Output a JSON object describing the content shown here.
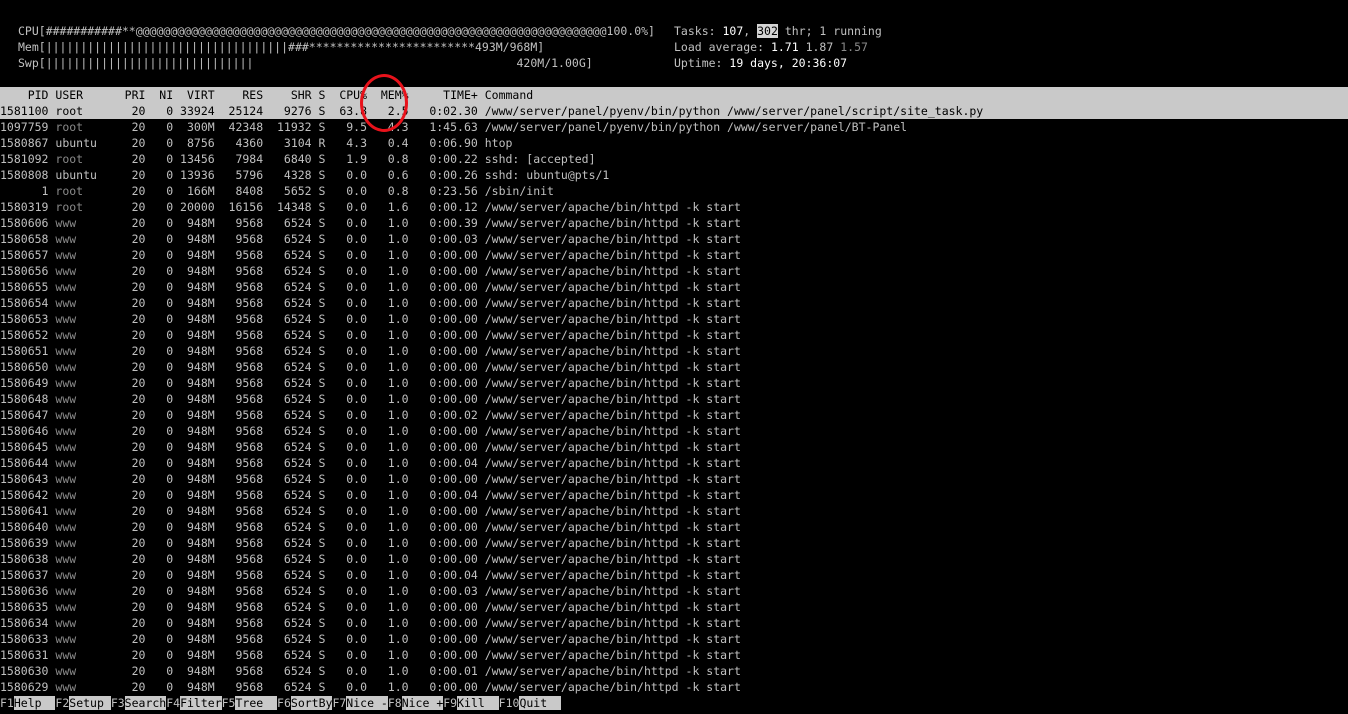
{
  "meters": {
    "cpu": {
      "label": "CPU",
      "bar": "[###########**@@@@@@@@@@@@@@@@@@@@@@@@@@@@@@@@@@@@@@@@@@@@@@@@@@@@@@@@@@@@@@@@@@@@100.0%]"
    },
    "mem": {
      "label": "Mem",
      "bar": "[|||||||||||||||||||||||||||||||||||###************************493M/968M]"
    },
    "swp": {
      "label": "Swp",
      "bar": "[||||||||||||||||||||||||||||||                                      420M/1.00G]"
    }
  },
  "summary": {
    "tasks_label": "Tasks: ",
    "tasks_count": "107",
    "tasks_sep": ", ",
    "threads_count": "302",
    "tasks_suffix": " thr; 1 running",
    "load_label": "Load average: ",
    "load_1": "1.71",
    "load_5": "1.87",
    "load_15": "1.57",
    "uptime_label": "Uptime: ",
    "uptime_value": "19 days, 20:36:07"
  },
  "table": {
    "headers": [
      "PID",
      "USER",
      "PRI",
      "NI",
      "VIRT",
      "RES",
      "SHR",
      "S",
      "CPU%",
      "MEM%",
      "TIME+",
      "Command"
    ],
    "rows": [
      {
        "pid": "1581100",
        "user": "root",
        "pri": "20",
        "ni": "0",
        "virt": "33924",
        "res": "25124",
        "shr": "9276",
        "s": "S",
        "cpu": "63.8",
        "mem": "2.5",
        "time": "0:02.30",
        "cmd": "/www/server/panel/pyenv/bin/python /www/server/panel/script/site_task.py"
      },
      {
        "pid": "1097759",
        "user": "root",
        "pri": "20",
        "ni": "0",
        "virt": "300M",
        "res": "42348",
        "shr": "11932",
        "s": "S",
        "cpu": "9.5",
        "mem": "4.3",
        "time": "1:45.63",
        "cmd": "/www/server/panel/pyenv/bin/python /www/server/panel/BT-Panel"
      },
      {
        "pid": "1580867",
        "user": "ubuntu",
        "pri": "20",
        "ni": "0",
        "virt": "8756",
        "res": "4360",
        "shr": "3104",
        "s": "R",
        "cpu": "4.3",
        "mem": "0.4",
        "time": "0:06.90",
        "cmd": "htop"
      },
      {
        "pid": "1581092",
        "user": "root",
        "pri": "20",
        "ni": "0",
        "virt": "13456",
        "res": "7984",
        "shr": "6840",
        "s": "S",
        "cpu": "1.9",
        "mem": "0.8",
        "time": "0:00.22",
        "cmd": "sshd: [accepted]"
      },
      {
        "pid": "1580808",
        "user": "ubuntu",
        "pri": "20",
        "ni": "0",
        "virt": "13936",
        "res": "5796",
        "shr": "4328",
        "s": "S",
        "cpu": "0.0",
        "mem": "0.6",
        "time": "0:00.26",
        "cmd": "sshd: ubuntu@pts/1"
      },
      {
        "pid": "1",
        "user": "root",
        "pri": "20",
        "ni": "0",
        "virt": "166M",
        "res": "8408",
        "shr": "5652",
        "s": "S",
        "cpu": "0.0",
        "mem": "0.8",
        "time": "0:23.56",
        "cmd": "/sbin/init"
      },
      {
        "pid": "1580319",
        "user": "root",
        "pri": "20",
        "ni": "0",
        "virt": "20000",
        "res": "16156",
        "shr": "14348",
        "s": "S",
        "cpu": "0.0",
        "mem": "1.6",
        "time": "0:00.12",
        "cmd": "/www/server/apache/bin/httpd -k start"
      },
      {
        "pid": "1580606",
        "user": "www",
        "pri": "20",
        "ni": "0",
        "virt": "948M",
        "res": "9568",
        "shr": "6524",
        "s": "S",
        "cpu": "0.0",
        "mem": "1.0",
        "time": "0:00.39",
        "cmd": "/www/server/apache/bin/httpd -k start"
      },
      {
        "pid": "1580658",
        "user": "www",
        "pri": "20",
        "ni": "0",
        "virt": "948M",
        "res": "9568",
        "shr": "6524",
        "s": "S",
        "cpu": "0.0",
        "mem": "1.0",
        "time": "0:00.03",
        "cmd": "/www/server/apache/bin/httpd -k start"
      },
      {
        "pid": "1580657",
        "user": "www",
        "pri": "20",
        "ni": "0",
        "virt": "948M",
        "res": "9568",
        "shr": "6524",
        "s": "S",
        "cpu": "0.0",
        "mem": "1.0",
        "time": "0:00.00",
        "cmd": "/www/server/apache/bin/httpd -k start"
      },
      {
        "pid": "1580656",
        "user": "www",
        "pri": "20",
        "ni": "0",
        "virt": "948M",
        "res": "9568",
        "shr": "6524",
        "s": "S",
        "cpu": "0.0",
        "mem": "1.0",
        "time": "0:00.00",
        "cmd": "/www/server/apache/bin/httpd -k start"
      },
      {
        "pid": "1580655",
        "user": "www",
        "pri": "20",
        "ni": "0",
        "virt": "948M",
        "res": "9568",
        "shr": "6524",
        "s": "S",
        "cpu": "0.0",
        "mem": "1.0",
        "time": "0:00.00",
        "cmd": "/www/server/apache/bin/httpd -k start"
      },
      {
        "pid": "1580654",
        "user": "www",
        "pri": "20",
        "ni": "0",
        "virt": "948M",
        "res": "9568",
        "shr": "6524",
        "s": "S",
        "cpu": "0.0",
        "mem": "1.0",
        "time": "0:00.00",
        "cmd": "/www/server/apache/bin/httpd -k start"
      },
      {
        "pid": "1580653",
        "user": "www",
        "pri": "20",
        "ni": "0",
        "virt": "948M",
        "res": "9568",
        "shr": "6524",
        "s": "S",
        "cpu": "0.0",
        "mem": "1.0",
        "time": "0:00.00",
        "cmd": "/www/server/apache/bin/httpd -k start"
      },
      {
        "pid": "1580652",
        "user": "www",
        "pri": "20",
        "ni": "0",
        "virt": "948M",
        "res": "9568",
        "shr": "6524",
        "s": "S",
        "cpu": "0.0",
        "mem": "1.0",
        "time": "0:00.00",
        "cmd": "/www/server/apache/bin/httpd -k start"
      },
      {
        "pid": "1580651",
        "user": "www",
        "pri": "20",
        "ni": "0",
        "virt": "948M",
        "res": "9568",
        "shr": "6524",
        "s": "S",
        "cpu": "0.0",
        "mem": "1.0",
        "time": "0:00.00",
        "cmd": "/www/server/apache/bin/httpd -k start"
      },
      {
        "pid": "1580650",
        "user": "www",
        "pri": "20",
        "ni": "0",
        "virt": "948M",
        "res": "9568",
        "shr": "6524",
        "s": "S",
        "cpu": "0.0",
        "mem": "1.0",
        "time": "0:00.00",
        "cmd": "/www/server/apache/bin/httpd -k start"
      },
      {
        "pid": "1580649",
        "user": "www",
        "pri": "20",
        "ni": "0",
        "virt": "948M",
        "res": "9568",
        "shr": "6524",
        "s": "S",
        "cpu": "0.0",
        "mem": "1.0",
        "time": "0:00.00",
        "cmd": "/www/server/apache/bin/httpd -k start"
      },
      {
        "pid": "1580648",
        "user": "www",
        "pri": "20",
        "ni": "0",
        "virt": "948M",
        "res": "9568",
        "shr": "6524",
        "s": "S",
        "cpu": "0.0",
        "mem": "1.0",
        "time": "0:00.00",
        "cmd": "/www/server/apache/bin/httpd -k start"
      },
      {
        "pid": "1580647",
        "user": "www",
        "pri": "20",
        "ni": "0",
        "virt": "948M",
        "res": "9568",
        "shr": "6524",
        "s": "S",
        "cpu": "0.0",
        "mem": "1.0",
        "time": "0:00.02",
        "cmd": "/www/server/apache/bin/httpd -k start"
      },
      {
        "pid": "1580646",
        "user": "www",
        "pri": "20",
        "ni": "0",
        "virt": "948M",
        "res": "9568",
        "shr": "6524",
        "s": "S",
        "cpu": "0.0",
        "mem": "1.0",
        "time": "0:00.00",
        "cmd": "/www/server/apache/bin/httpd -k start"
      },
      {
        "pid": "1580645",
        "user": "www",
        "pri": "20",
        "ni": "0",
        "virt": "948M",
        "res": "9568",
        "shr": "6524",
        "s": "S",
        "cpu": "0.0",
        "mem": "1.0",
        "time": "0:00.00",
        "cmd": "/www/server/apache/bin/httpd -k start"
      },
      {
        "pid": "1580644",
        "user": "www",
        "pri": "20",
        "ni": "0",
        "virt": "948M",
        "res": "9568",
        "shr": "6524",
        "s": "S",
        "cpu": "0.0",
        "mem": "1.0",
        "time": "0:00.04",
        "cmd": "/www/server/apache/bin/httpd -k start"
      },
      {
        "pid": "1580643",
        "user": "www",
        "pri": "20",
        "ni": "0",
        "virt": "948M",
        "res": "9568",
        "shr": "6524",
        "s": "S",
        "cpu": "0.0",
        "mem": "1.0",
        "time": "0:00.00",
        "cmd": "/www/server/apache/bin/httpd -k start"
      },
      {
        "pid": "1580642",
        "user": "www",
        "pri": "20",
        "ni": "0",
        "virt": "948M",
        "res": "9568",
        "shr": "6524",
        "s": "S",
        "cpu": "0.0",
        "mem": "1.0",
        "time": "0:00.04",
        "cmd": "/www/server/apache/bin/httpd -k start"
      },
      {
        "pid": "1580641",
        "user": "www",
        "pri": "20",
        "ni": "0",
        "virt": "948M",
        "res": "9568",
        "shr": "6524",
        "s": "S",
        "cpu": "0.0",
        "mem": "1.0",
        "time": "0:00.00",
        "cmd": "/www/server/apache/bin/httpd -k start"
      },
      {
        "pid": "1580640",
        "user": "www",
        "pri": "20",
        "ni": "0",
        "virt": "948M",
        "res": "9568",
        "shr": "6524",
        "s": "S",
        "cpu": "0.0",
        "mem": "1.0",
        "time": "0:00.00",
        "cmd": "/www/server/apache/bin/httpd -k start"
      },
      {
        "pid": "1580639",
        "user": "www",
        "pri": "20",
        "ni": "0",
        "virt": "948M",
        "res": "9568",
        "shr": "6524",
        "s": "S",
        "cpu": "0.0",
        "mem": "1.0",
        "time": "0:00.00",
        "cmd": "/www/server/apache/bin/httpd -k start"
      },
      {
        "pid": "1580638",
        "user": "www",
        "pri": "20",
        "ni": "0",
        "virt": "948M",
        "res": "9568",
        "shr": "6524",
        "s": "S",
        "cpu": "0.0",
        "mem": "1.0",
        "time": "0:00.00",
        "cmd": "/www/server/apache/bin/httpd -k start"
      },
      {
        "pid": "1580637",
        "user": "www",
        "pri": "20",
        "ni": "0",
        "virt": "948M",
        "res": "9568",
        "shr": "6524",
        "s": "S",
        "cpu": "0.0",
        "mem": "1.0",
        "time": "0:00.04",
        "cmd": "/www/server/apache/bin/httpd -k start"
      },
      {
        "pid": "1580636",
        "user": "www",
        "pri": "20",
        "ni": "0",
        "virt": "948M",
        "res": "9568",
        "shr": "6524",
        "s": "S",
        "cpu": "0.0",
        "mem": "1.0",
        "time": "0:00.03",
        "cmd": "/www/server/apache/bin/httpd -k start"
      },
      {
        "pid": "1580635",
        "user": "www",
        "pri": "20",
        "ni": "0",
        "virt": "948M",
        "res": "9568",
        "shr": "6524",
        "s": "S",
        "cpu": "0.0",
        "mem": "1.0",
        "time": "0:00.00",
        "cmd": "/www/server/apache/bin/httpd -k start"
      },
      {
        "pid": "1580634",
        "user": "www",
        "pri": "20",
        "ni": "0",
        "virt": "948M",
        "res": "9568",
        "shr": "6524",
        "s": "S",
        "cpu": "0.0",
        "mem": "1.0",
        "time": "0:00.00",
        "cmd": "/www/server/apache/bin/httpd -k start"
      },
      {
        "pid": "1580633",
        "user": "www",
        "pri": "20",
        "ni": "0",
        "virt": "948M",
        "res": "9568",
        "shr": "6524",
        "s": "S",
        "cpu": "0.0",
        "mem": "1.0",
        "time": "0:00.00",
        "cmd": "/www/server/apache/bin/httpd -k start"
      },
      {
        "pid": "1580631",
        "user": "www",
        "pri": "20",
        "ni": "0",
        "virt": "948M",
        "res": "9568",
        "shr": "6524",
        "s": "S",
        "cpu": "0.0",
        "mem": "1.0",
        "time": "0:00.00",
        "cmd": "/www/server/apache/bin/httpd -k start"
      },
      {
        "pid": "1580630",
        "user": "www",
        "pri": "20",
        "ni": "0",
        "virt": "948M",
        "res": "9568",
        "shr": "6524",
        "s": "S",
        "cpu": "0.0",
        "mem": "1.0",
        "time": "0:00.01",
        "cmd": "/www/server/apache/bin/httpd -k start"
      },
      {
        "pid": "1580629",
        "user": "www",
        "pri": "20",
        "ni": "0",
        "virt": "948M",
        "res": "9568",
        "shr": "6524",
        "s": "S",
        "cpu": "0.0",
        "mem": "1.0",
        "time": "0:00.00",
        "cmd": "/www/server/apache/bin/httpd -k start"
      }
    ]
  },
  "footer": [
    {
      "key": "F1",
      "label": "Help  "
    },
    {
      "key": "F2",
      "label": "Setup "
    },
    {
      "key": "F3",
      "label": "Search"
    },
    {
      "key": "F4",
      "label": "Filter"
    },
    {
      "key": "F5",
      "label": "Tree  "
    },
    {
      "key": "F6",
      "label": "SortBy"
    },
    {
      "key": "F7",
      "label": "Nice -"
    },
    {
      "key": "F8",
      "label": "Nice +"
    },
    {
      "key": "F9",
      "label": "Kill  "
    },
    {
      "key": "F10",
      "label": "Quit  "
    }
  ],
  "colors": {
    "highlight_bar": "#c9c9c9",
    "annotation_circle": "#e8121b",
    "background": "#000000"
  }
}
